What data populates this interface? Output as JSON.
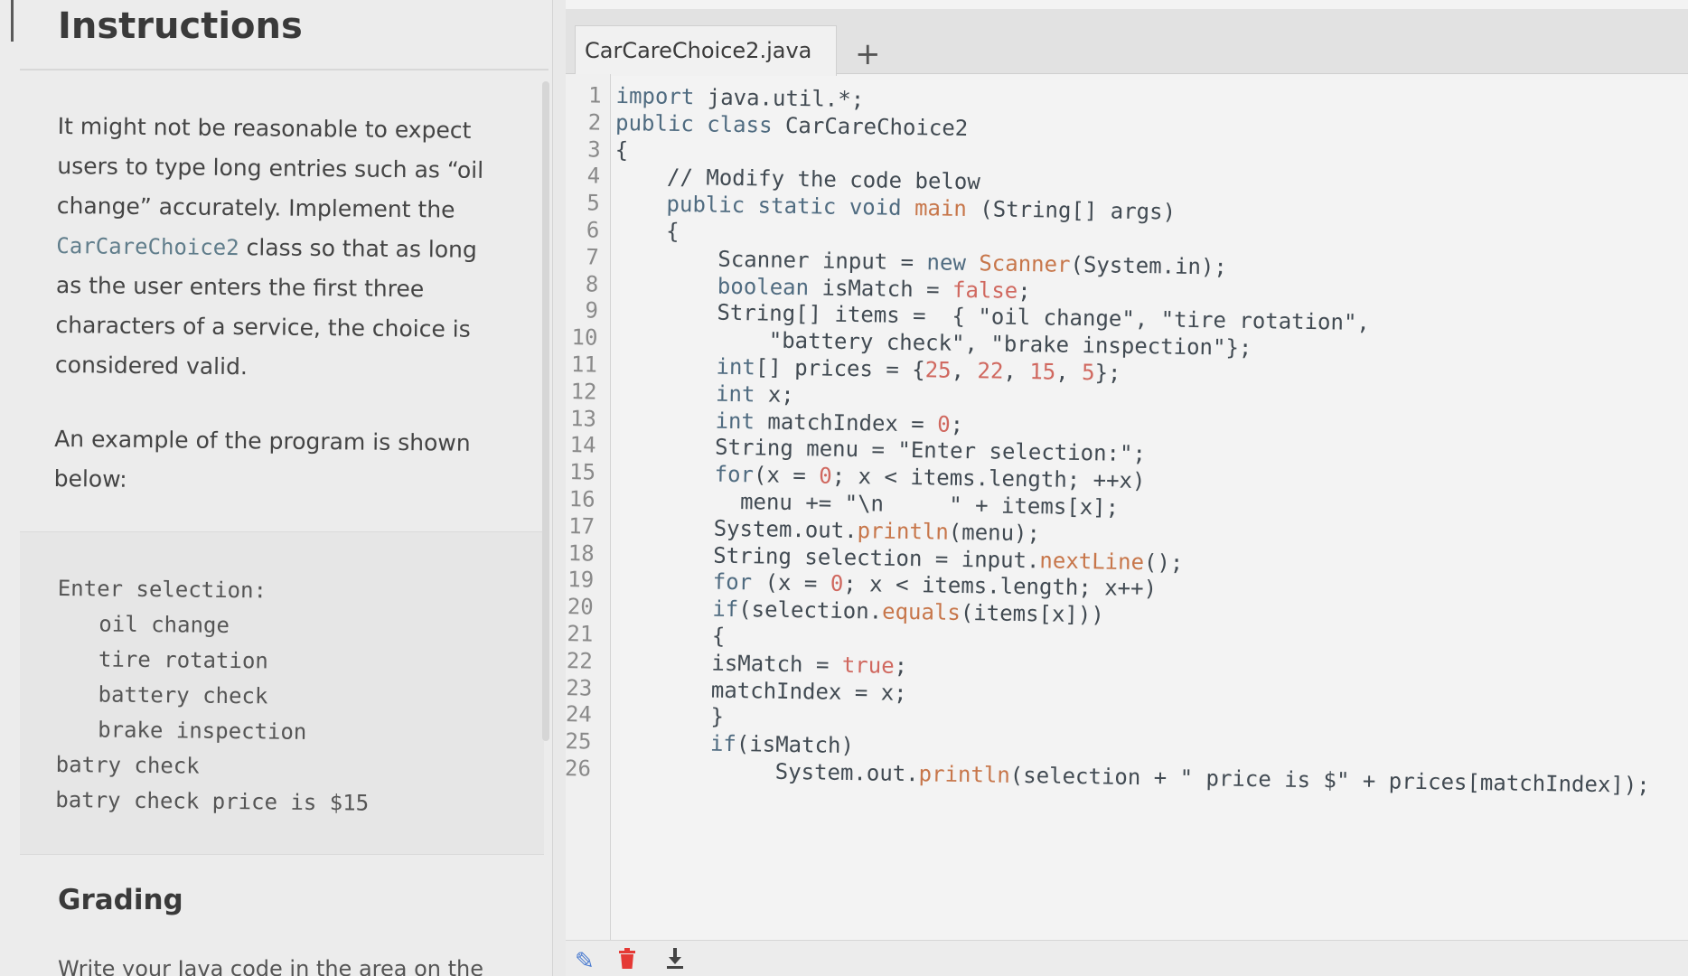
{
  "instructions": {
    "title": "Instructions",
    "para1_a": "It might not be reasonable to expect users to type long entries such as “oil change” accurately. Implement the ",
    "para1_class": "CarCareChoice2",
    "para1_b": " class so that as long as the user enters the first three characters of a service, the choice is considered valid.",
    "para2": "An example of the program is shown below:",
    "example": [
      {
        "text": "Enter selection:",
        "indent": false
      },
      {
        "text": "oil change",
        "indent": true
      },
      {
        "text": "tire rotation",
        "indent": true
      },
      {
        "text": "battery check",
        "indent": true
      },
      {
        "text": "brake inspection",
        "indent": true
      },
      {
        "text": "batry check",
        "indent": false
      },
      {
        "text": "batry check price is $15",
        "indent": false
      }
    ],
    "grading_title": "Grading",
    "grading_text": "Write your Java code in the area on the"
  },
  "editor": {
    "tab_label": "CarCareChoice2.java",
    "add_tab_label": "+",
    "lines": [
      [
        [
          "kw",
          "import"
        ],
        [
          "p",
          " java.util.*;"
        ]
      ],
      [
        [
          "kw",
          "public class"
        ],
        [
          "p",
          " CarCareChoice2"
        ]
      ],
      [
        [
          "p",
          "{"
        ]
      ],
      [
        [
          "p",
          "    // Modify the code below"
        ]
      ],
      [
        [
          "p",
          "    "
        ],
        [
          "kw",
          "public static void"
        ],
        [
          "p",
          " "
        ],
        [
          "fn",
          "main"
        ],
        [
          "p",
          " (String[] args)"
        ]
      ],
      [
        [
          "p",
          "    {"
        ]
      ],
      [
        [
          "p",
          "        Scanner input = "
        ],
        [
          "kw",
          "new"
        ],
        [
          "p",
          " "
        ],
        [
          "fn",
          "Scanner"
        ],
        [
          "p",
          "(System.in);"
        ]
      ],
      [
        [
          "p",
          "        "
        ],
        [
          "kw",
          "boolean"
        ],
        [
          "p",
          " isMatch = "
        ],
        [
          "num",
          "false"
        ],
        [
          "p",
          ";"
        ]
      ],
      [
        [
          "p",
          "        String[] items =  { \"oil change\", \"tire rotation\","
        ]
      ],
      [
        [
          "p",
          "            \"battery check\", \"brake inspection\"};"
        ]
      ],
      [
        [
          "p",
          "        "
        ],
        [
          "kw",
          "int"
        ],
        [
          "p",
          "[] prices = {"
        ],
        [
          "num",
          "25"
        ],
        [
          "p",
          ", "
        ],
        [
          "num",
          "22"
        ],
        [
          "p",
          ", "
        ],
        [
          "num",
          "15"
        ],
        [
          "p",
          ", "
        ],
        [
          "num",
          "5"
        ],
        [
          "p",
          "};"
        ]
      ],
      [
        [
          "p",
          "        "
        ],
        [
          "kw",
          "int"
        ],
        [
          "p",
          " x;"
        ]
      ],
      [
        [
          "p",
          "        "
        ],
        [
          "kw",
          "int"
        ],
        [
          "p",
          " matchIndex = "
        ],
        [
          "num",
          "0"
        ],
        [
          "p",
          ";"
        ]
      ],
      [
        [
          "p",
          "        String menu = \"Enter selection:\";"
        ]
      ],
      [
        [
          "p",
          "        "
        ],
        [
          "kw",
          "for"
        ],
        [
          "p",
          "(x = "
        ],
        [
          "num",
          "0"
        ],
        [
          "p",
          "; x < items.length; ++x)"
        ]
      ],
      [
        [
          "p",
          "          menu += \"\\n     \" + items[x];"
        ]
      ],
      [
        [
          "p",
          "        System.out."
        ],
        [
          "fn",
          "println"
        ],
        [
          "p",
          "(menu);"
        ]
      ],
      [
        [
          "p",
          "        String selection = input."
        ],
        [
          "fn",
          "nextLine"
        ],
        [
          "p",
          "();"
        ]
      ],
      [
        [
          "p",
          "        "
        ],
        [
          "kw",
          "for"
        ],
        [
          "p",
          " (x = "
        ],
        [
          "num",
          "0"
        ],
        [
          "p",
          "; x < items.length; x++)"
        ]
      ],
      [
        [
          "p",
          "        "
        ],
        [
          "kw",
          "if"
        ],
        [
          "p",
          "(selection."
        ],
        [
          "fn",
          "equals"
        ],
        [
          "p",
          "(items[x]))"
        ]
      ],
      [
        [
          "p",
          "        {"
        ]
      ],
      [
        [
          "p",
          "        isMatch = "
        ],
        [
          "num",
          "true"
        ],
        [
          "p",
          ";"
        ]
      ],
      [
        [
          "p",
          "        matchIndex = x;"
        ]
      ],
      [
        [
          "p",
          "        }"
        ]
      ],
      [
        [
          "p",
          "        "
        ],
        [
          "kw",
          "if"
        ],
        [
          "p",
          "(isMatch)"
        ]
      ],
      [
        [
          "p",
          "             System.out."
        ],
        [
          "fn",
          "println"
        ],
        [
          "p",
          "(selection + \" price is $\" + prices[matchIndex]);"
        ]
      ]
    ],
    "line_numbers": [
      "1",
      "2",
      "3",
      "4",
      "5",
      "6",
      "7",
      "8",
      "9",
      "10",
      "11",
      "12",
      "13",
      "14",
      "15",
      "16",
      "17",
      "18",
      "19",
      "20",
      "21",
      "22",
      "23",
      "24",
      "25",
      "26"
    ]
  },
  "toolbar_icons": [
    "pencil-icon",
    "trash-icon",
    "download-icon"
  ],
  "colors": {
    "keyword": "#4f6b80",
    "function": "#c7764a",
    "number": "#d0685f",
    "delete": "#e53935"
  }
}
